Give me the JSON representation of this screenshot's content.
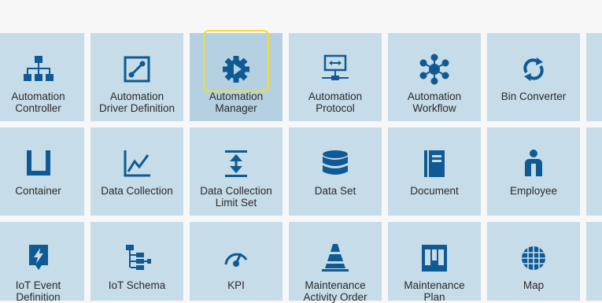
{
  "accent_color": "#0f5a94",
  "tile_color": "#c6dce8",
  "focus_color": "#f3dd2b",
  "tiles": [
    {
      "line1": "Automation",
      "line2": "Controller",
      "icon": "hierarchy-icon"
    },
    {
      "line1": "Automation",
      "line2": "Driver Definition",
      "icon": "driver-link-icon"
    },
    {
      "line1": "Automation",
      "line2": "Manager",
      "icon": "gear-play-icon"
    },
    {
      "line1": "Automation",
      "line2": "Protocol",
      "icon": "protocol-icon"
    },
    {
      "line1": "Automation",
      "line2": "Workflow",
      "icon": "workflow-icon"
    },
    {
      "line1": "Bin Converter",
      "line2": "",
      "icon": "refresh-icon"
    },
    {
      "line1": "Container",
      "line2": "",
      "icon": "container-icon"
    },
    {
      "line1": "Data Collection",
      "line2": "",
      "icon": "line-chart-icon"
    },
    {
      "line1": "Data Collection",
      "line2": "Limit Set",
      "icon": "limit-set-icon"
    },
    {
      "line1": "Data Set",
      "line2": "",
      "icon": "database-icon"
    },
    {
      "line1": "Document",
      "line2": "",
      "icon": "document-icon"
    },
    {
      "line1": "Employee",
      "line2": "",
      "icon": "employee-icon"
    },
    {
      "line1": "IoT Event",
      "line2": "Definition",
      "icon": "iot-event-icon"
    },
    {
      "line1": "IoT Schema",
      "line2": "",
      "icon": "schema-icon"
    },
    {
      "line1": "KPI",
      "line2": "",
      "icon": "gauge-icon"
    },
    {
      "line1": "Maintenance",
      "line2": "Activity Order",
      "icon": "cone-icon"
    },
    {
      "line1": "Maintenance",
      "line2": "Plan",
      "icon": "maintenance-plan-icon"
    },
    {
      "line1": "Map",
      "line2": "",
      "icon": "map-icon"
    }
  ]
}
